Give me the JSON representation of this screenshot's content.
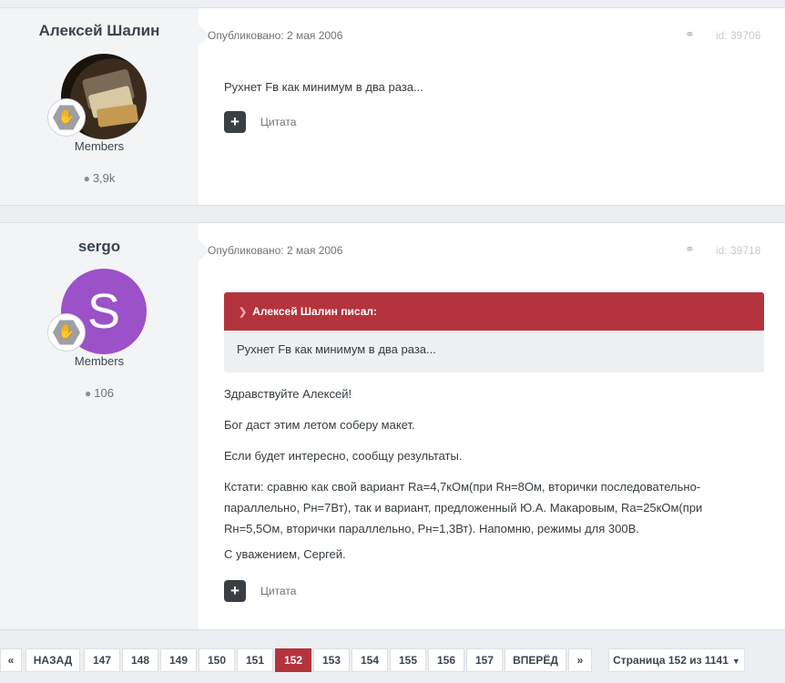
{
  "posts": [
    {
      "author": "Алексей Шалин",
      "group": "Members",
      "post_count": "3,9k",
      "published": "Опубликовано: 2 мая 2006",
      "id": "id: 39706",
      "body": "Рухнет Fв как минимум в два раза...",
      "quote_label": "Цитата"
    },
    {
      "author": "sergo",
      "avatar_letter": "S",
      "group": "Members",
      "post_count": "106",
      "published": "Опубликовано: 2 мая 2006",
      "id": "id: 39718",
      "quote": {
        "header": "Алексей Шалин писал:",
        "text": "Рухнет Fв как минимум в два раза..."
      },
      "paragraphs": [
        "Здравствуйте Алексей!",
        "Бог даст этим летом соберу макет.",
        "Если будет интересно, сообщу результаты.",
        "Кстати: сравню как свой вариант Ra=4,7кОм(при Rн=8Ом, вторички последовательно-параллельно, Pн=7Вт), так и вариант, предложенный Ю.А. Макаровым, Ra=25кОм(при Rн=5,5Ом, вторички параллельно, Pн=1,3Вт). Напомню, режимы для 300В.",
        "С уважением, Сергей."
      ],
      "quote_label": "Цитата"
    }
  ],
  "icons": {
    "comment": "speech-bubble",
    "share": "share",
    "rank": "hand-rank-badge",
    "chevron": "chevron-down"
  },
  "pagination": {
    "first": "«",
    "prev": "НАЗАД",
    "pages": [
      "147",
      "148",
      "149",
      "150",
      "151",
      "152",
      "153",
      "154",
      "155",
      "156",
      "157"
    ],
    "current": "152",
    "next": "ВПЕРЁД",
    "last": "»",
    "page_label": "Страница 152 из 1141"
  },
  "colors": {
    "accent": "#b5333c",
    "avatar_bg": "#9b51c8",
    "sidebar_bg": "#f3f4f6"
  }
}
